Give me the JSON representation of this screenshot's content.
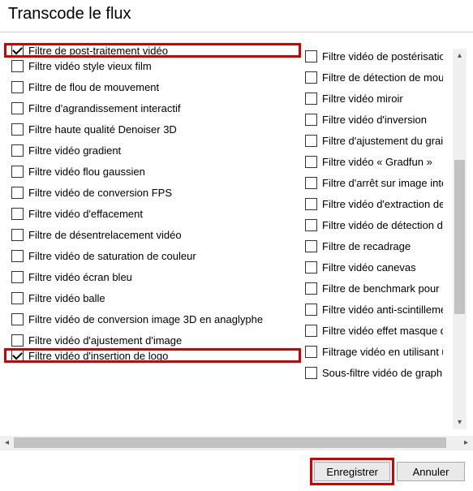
{
  "title": "Transcode le flux",
  "leftFilters": [
    {
      "label": "Filtre de post-traitement vidéo",
      "checked": true,
      "highlight": true
    },
    {
      "label": "Filtre vidéo style vieux film",
      "checked": false
    },
    {
      "label": "Filtre de flou de mouvement",
      "checked": false
    },
    {
      "label": "Filtre d'agrandissement interactif",
      "checked": false
    },
    {
      "label": "Filtre haute qualité Denoiser 3D",
      "checked": false
    },
    {
      "label": "Filtre vidéo gradient",
      "checked": false
    },
    {
      "label": "Filtre vidéo flou gaussien",
      "checked": false
    },
    {
      "label": "Filtre vidéo de conversion FPS",
      "checked": false
    },
    {
      "label": "Filtre vidéo d'effacement",
      "checked": false
    },
    {
      "label": "Filtre de désentrelacement vidéo",
      "checked": false
    },
    {
      "label": "Filtre vidéo de saturation de couleur",
      "checked": false
    },
    {
      "label": "Filtre vidéo écran bleu",
      "checked": false
    },
    {
      "label": "Filtre vidéo balle",
      "checked": false
    },
    {
      "label": "Filtre vidéo de conversion image 3D en anaglyphe",
      "checked": false
    },
    {
      "label": "Filtre vidéo d'ajustement d'image",
      "checked": false
    },
    {
      "label": "Filtre vidéo d'insertion de logo",
      "checked": true,
      "highlight": true
    }
  ],
  "rightFilters": [
    {
      "label": "Filtre vidéo de postérisation",
      "checked": false
    },
    {
      "label": "Filtre de détection de mouvem",
      "checked": false
    },
    {
      "label": "Filtre vidéo miroir",
      "checked": false
    },
    {
      "label": "Filtre vidéo d'inversion",
      "checked": false
    },
    {
      "label": "Filtre d'ajustement du grain",
      "checked": false
    },
    {
      "label": "Filtre vidéo « Gradfun »",
      "checked": false
    },
    {
      "label": "Filtre d'arrêt sur image interac",
      "checked": false
    },
    {
      "label": "Filtre vidéo d'extraction de con",
      "checked": false
    },
    {
      "label": "Filtre vidéo de détection des b",
      "checked": false
    },
    {
      "label": "Filtre de recadrage",
      "checked": false
    },
    {
      "label": "Filtre vidéo canevas",
      "checked": false
    },
    {
      "label": "Filtre de benchmark pour le flo",
      "checked": false
    },
    {
      "label": "Filtre vidéo anti-scintillement",
      "checked": false
    },
    {
      "label": "Filtre vidéo effet masque de tr",
      "checked": false
    },
    {
      "label": "Filtrage vidéo en utilisant une o",
      "checked": false
    },
    {
      "label": "Sous-filtre vidéo de graphique",
      "checked": false
    }
  ],
  "buttons": {
    "save": "Enregistrer",
    "cancel": "Annuler"
  }
}
